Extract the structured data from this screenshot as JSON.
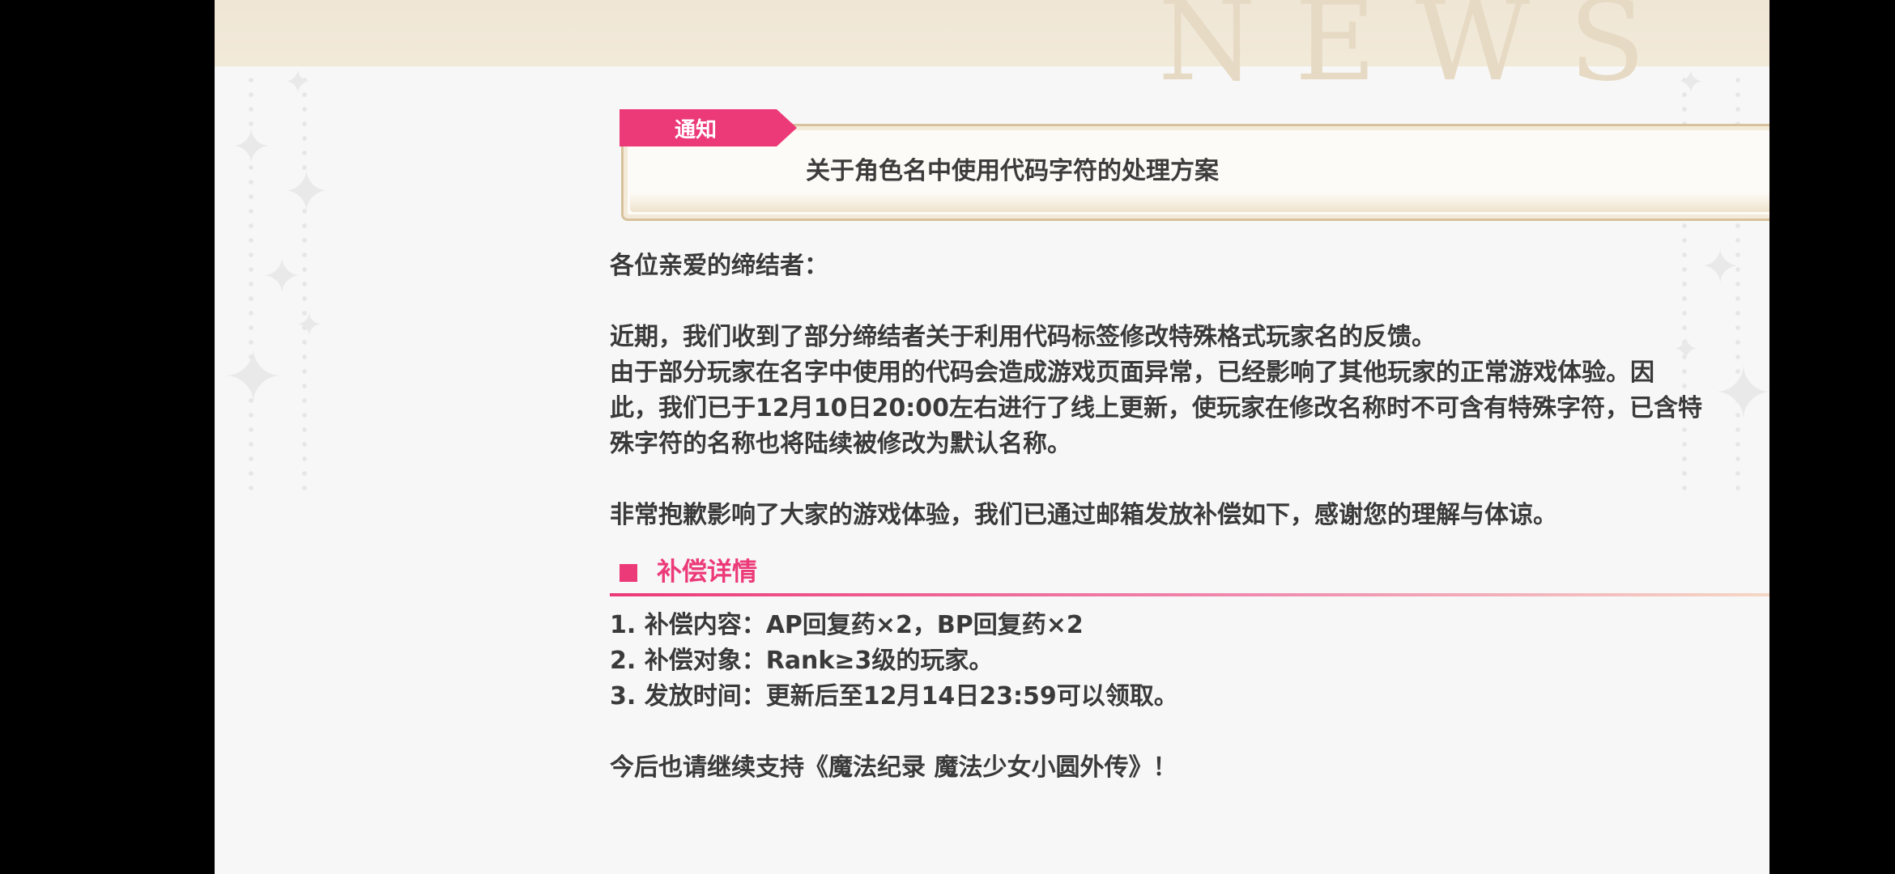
{
  "header": {
    "watermark": "NEWS",
    "close_label": "×"
  },
  "notice": {
    "tag": "通知",
    "title": "关于角色名中使用代码字符的处理方案"
  },
  "body": {
    "greeting": "各位亲爱的缔结者：",
    "paragraph1": [
      "近期，我们收到了部分缔结者关于利用代码标签修改特殊格式玩家名的反馈。",
      "由于部分玩家在名字中使用的代码会造成游戏页面异常，已经影响了其他玩家的正常游戏体验。因",
      "此，我们已于12月10日20:00左右进行了线上更新，使玩家在修改名称时不可含有特殊字符，已含特",
      "殊字符的名称也将陆续被修改为默认名称。"
    ],
    "apology": "非常抱歉影响了大家的游戏体验，我们已通过邮箱发放补偿如下，感谢您的理解与体谅。",
    "section_title": "补偿详情",
    "details": [
      "1.  补偿内容：AP回复药×2，BP回复药×2",
      "2.  补偿对象：Rank≥3级的玩家。",
      "3.  发放时间：更新后至12月14日23:59可以领取。"
    ],
    "closing": "今后也请继续支持《魔法纪录  魔法少女小圆外传》！"
  },
  "colors": {
    "accent_pink": "#ec3a78",
    "gold": "#d9b56a",
    "panel_bg": "#f7f7f7",
    "text": "#3a3a3a"
  },
  "icons": [
    "close-icon",
    "sparkle-icon"
  ]
}
